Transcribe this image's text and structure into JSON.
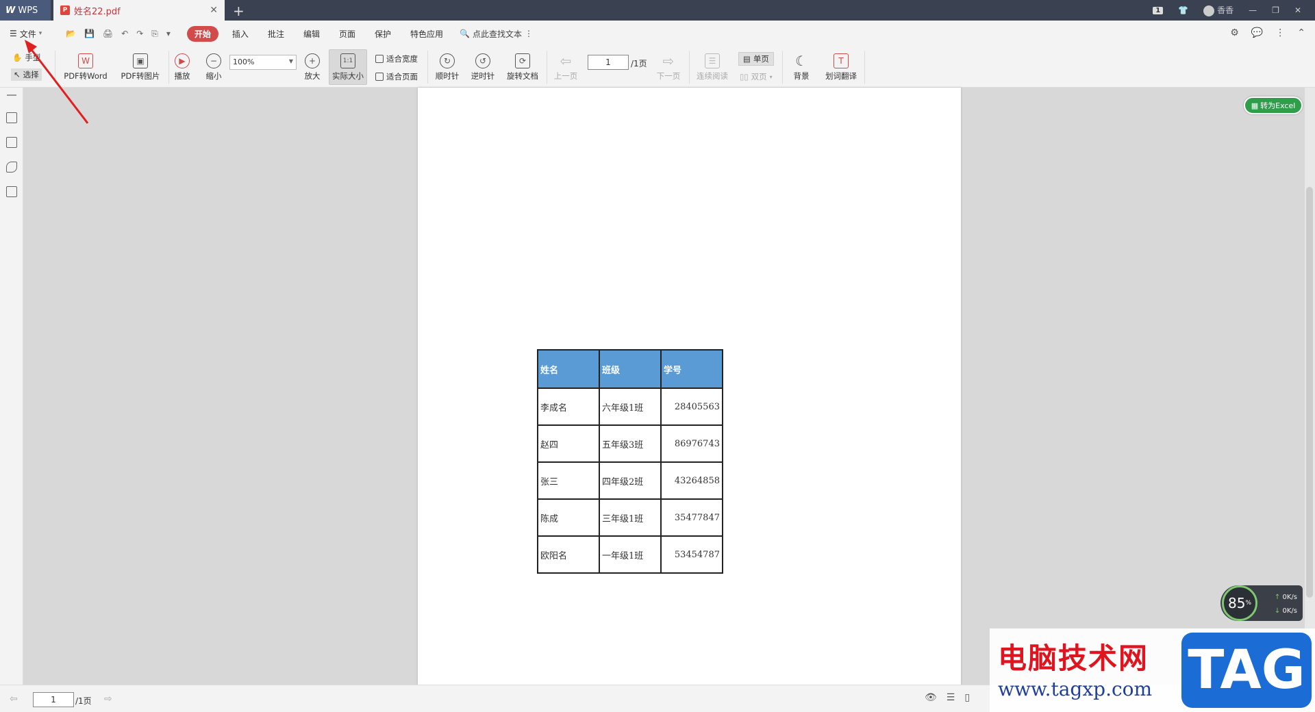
{
  "titlebar": {
    "app_name": "WPS",
    "doc_tab": "姓名22.pdf",
    "badge": "1",
    "user": "香香"
  },
  "menu": {
    "file_label": "文件",
    "tabs": [
      "开始",
      "插入",
      "批注",
      "编辑",
      "页面",
      "保护",
      "特色应用"
    ],
    "search_label": "点此查找文本"
  },
  "ribbon": {
    "hand": "手型",
    "select": "选择",
    "pdf_to_word": "PDF转Word",
    "pdf_to_image": "PDF转图片",
    "play": "播放",
    "zoom_out": "缩小",
    "zoom_value": "100%",
    "zoom_in": "放大",
    "actual_size": "实际大小",
    "fit_width": "适合宽度",
    "fit_page": "适合页面",
    "clockwise": "顺时针",
    "counterclockwise": "逆时针",
    "rotate_doc": "旋转文档",
    "prev_page": "上一页",
    "page_current": "1",
    "page_total": "/1页",
    "next_page": "下一页",
    "continuous": "连续阅读",
    "single": "单页",
    "double": "双页",
    "background": "背景",
    "translate": "划词翻译"
  },
  "excel_btn": "转为Excel",
  "table": {
    "headers": [
      "姓名",
      "班级",
      "学号"
    ],
    "rows": [
      [
        "李成名",
        "六年级1班",
        "28405563"
      ],
      [
        "赵四",
        "五年级3班",
        "86976743"
      ],
      [
        "张三",
        "四年级2班",
        "43264858"
      ],
      [
        "陈成",
        "三年级1班",
        "35477847"
      ],
      [
        "欧阳名",
        "一年级1班",
        "53454787"
      ]
    ]
  },
  "statusbar": {
    "page_current": "1",
    "page_total": "/1页"
  },
  "speed": {
    "percent": "85",
    "up": "0K/s",
    "down": "0K/s"
  },
  "watermark": {
    "cn": "电脑技术网",
    "url": "www.tagxp.com",
    "tag": "TAG"
  }
}
